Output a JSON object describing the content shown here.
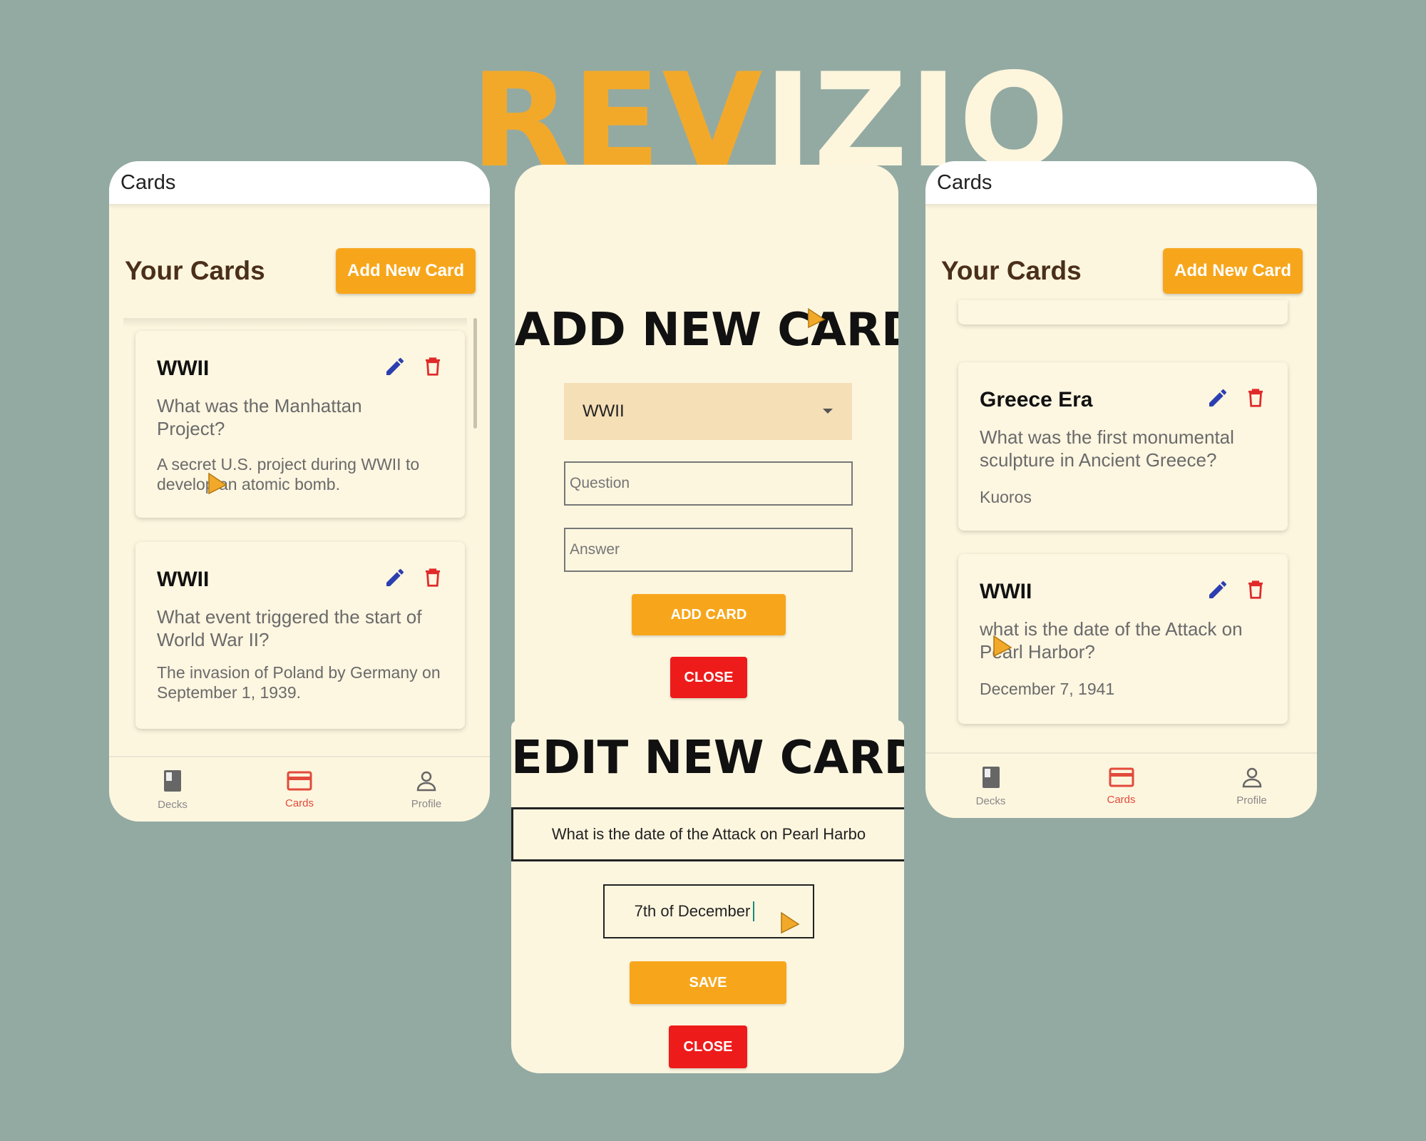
{
  "brand": {
    "part1": "REV",
    "part2": "IZIO"
  },
  "screen_left": {
    "appbar_title": "Cards",
    "heading": "Your Cards",
    "add_button": "Add New Card",
    "cards": [
      {
        "deck": "WWII",
        "question": "What was the Manhattan Project?",
        "answer": "A secret U.S. project during WWII to develop an atomic bomb."
      },
      {
        "deck": "WWII",
        "question": "What event triggered the start of World War II?",
        "answer": "The invasion of Poland by Germany on September 1, 1939."
      }
    ],
    "nav": [
      {
        "label": "Decks",
        "icon": "book-icon"
      },
      {
        "label": "Cards",
        "icon": "card-icon"
      },
      {
        "label": "Profile",
        "icon": "person-icon"
      }
    ]
  },
  "add_form": {
    "title": "ADD NEW CARD",
    "deck_selected": "WWII",
    "question_placeholder": "Question",
    "answer_placeholder": "Answer",
    "add_button": "ADD CARD",
    "close_button": "CLOSE"
  },
  "edit_form": {
    "title": "EDIT NEW CARD",
    "question_value": "What is the date of the Attack on Pearl Harbo",
    "answer_value": "7th of December",
    "save_button": "SAVE",
    "close_button": "CLOSE"
  },
  "screen_right": {
    "appbar_title": "Cards",
    "heading": "Your Cards",
    "add_button": "Add New Card",
    "cards": [
      {
        "deck": "Greece Era",
        "question": "What was the first monumental sculpture in Ancient Greece?",
        "answer": "Kuoros"
      },
      {
        "deck": "WWII",
        "question": "what is the date of the Attack on Pearl Harbor?",
        "answer": "December 7, 1941"
      }
    ],
    "nav": [
      {
        "label": "Decks",
        "icon": "book-icon"
      },
      {
        "label": "Cards",
        "icon": "card-icon"
      },
      {
        "label": "Profile",
        "icon": "person-icon"
      }
    ]
  },
  "colors": {
    "accent": "#f7a61b",
    "danger": "#ee1b1b",
    "background": "#93aaa3",
    "surface": "#fdf6df",
    "edit_icon": "#2c3fb0",
    "delete_icon": "#e02a2a"
  }
}
